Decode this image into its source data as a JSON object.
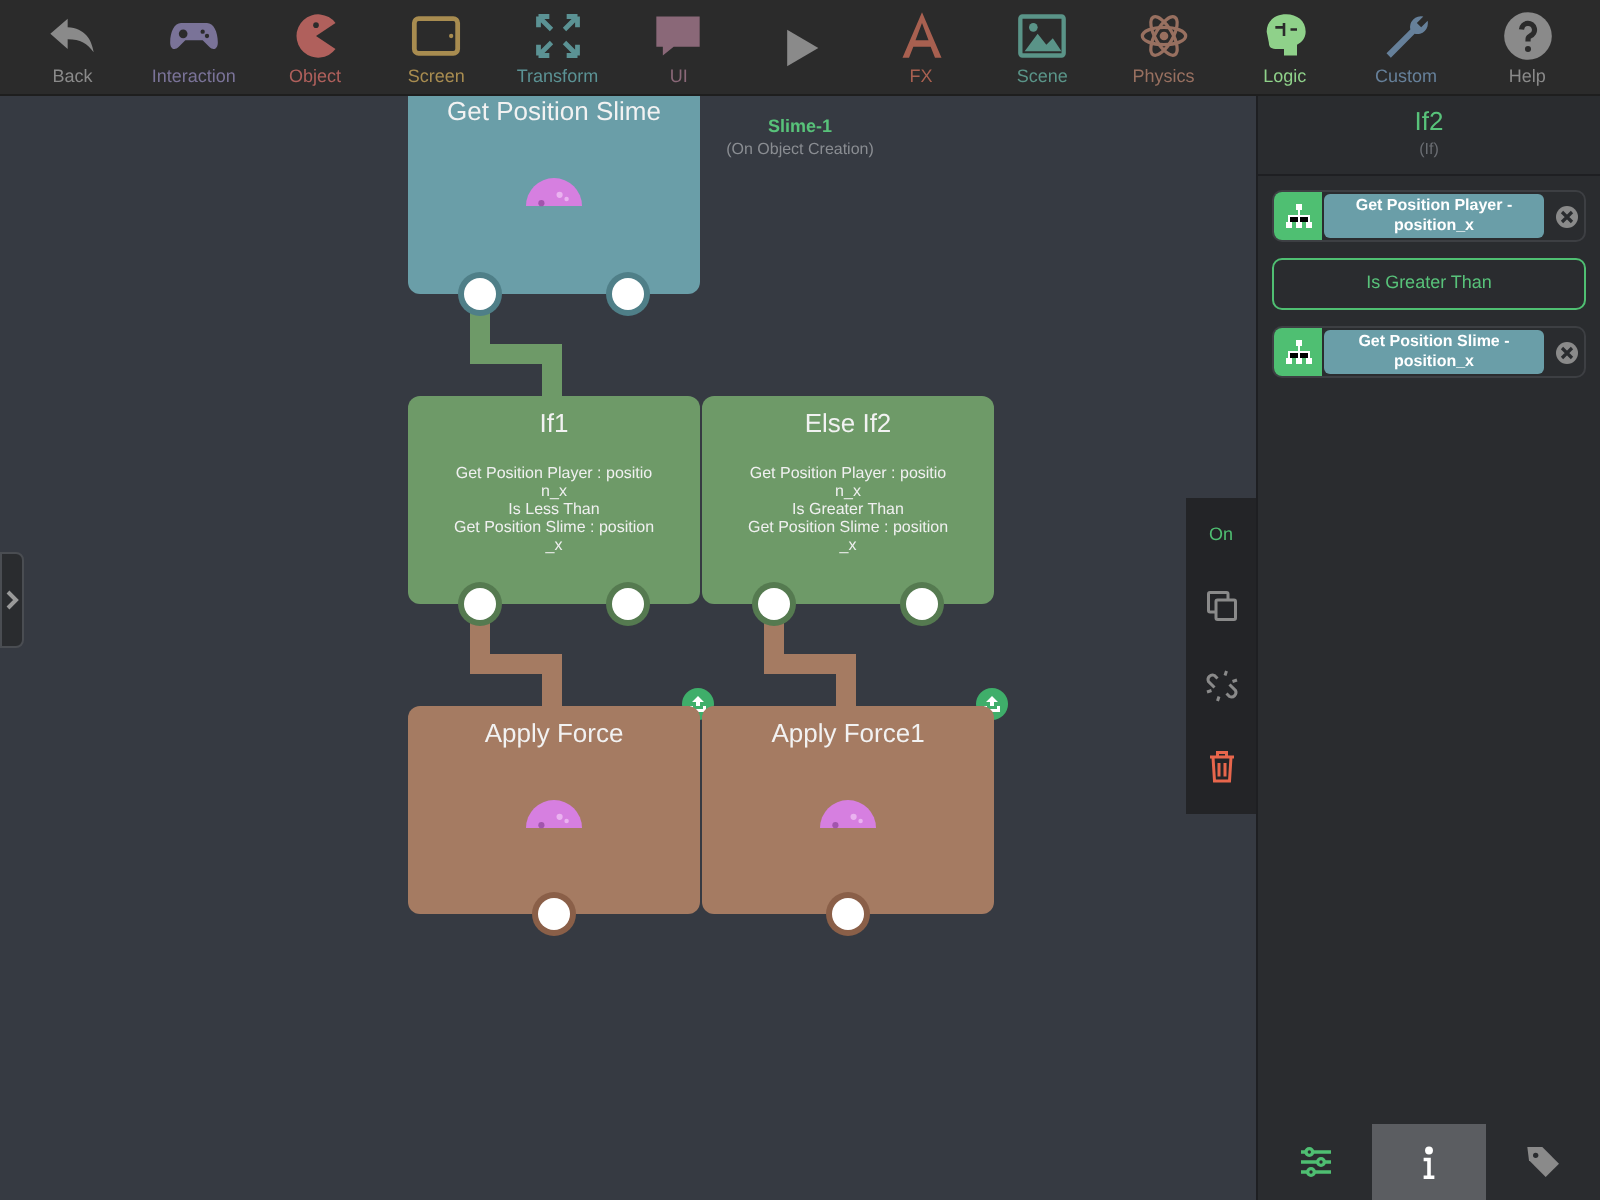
{
  "toolbar": [
    {
      "kind": "back",
      "label": "Back",
      "selected": false
    },
    {
      "kind": "gamepad",
      "label": "Interaction",
      "selected": false
    },
    {
      "kind": "pacman",
      "label": "Object",
      "selected": false
    },
    {
      "kind": "screen",
      "label": "Screen",
      "selected": false
    },
    {
      "kind": "transform",
      "label": "Transform",
      "selected": false
    },
    {
      "kind": "ui",
      "label": "UI",
      "selected": false
    },
    {
      "kind": "play",
      "selected": false
    },
    {
      "kind": "fx",
      "label": "FX",
      "selected": false
    },
    {
      "kind": "scene",
      "label": "Scene",
      "selected": false
    },
    {
      "kind": "physics",
      "label": "Physics",
      "selected": false
    },
    {
      "kind": "logic",
      "label": "Logic",
      "selected": true
    },
    {
      "kind": "custom",
      "label": "Custom",
      "selected": false
    },
    {
      "kind": "help",
      "label": "Help",
      "selected": false
    }
  ],
  "canvas": {
    "object_label": "Slime-1",
    "object_event": "(On Object Creation)",
    "nodes": [
      {
        "kind": "getter",
        "title": "Get Position Slime",
        "slime": true,
        "upload": false
      },
      {
        "kind": "condition",
        "title": "If1",
        "description": "Get Position Player : position_x\nIs Less Than\nGet Position Slime : position_x"
      },
      {
        "kind": "condition",
        "title": "Else If2",
        "description": "Get Position Player : position_x\nIs Greater Than\nGet Position Slime : position_x"
      },
      {
        "kind": "action",
        "title": "Apply Force",
        "slime": true,
        "upload": true
      },
      {
        "kind": "action",
        "title": "Apply Force1",
        "slime": true,
        "upload": true
      }
    ]
  },
  "side_tools": [
    {
      "kind": "toggle",
      "label": "On"
    },
    {
      "kind": "copy"
    },
    {
      "kind": "unlink"
    },
    {
      "kind": "delete"
    }
  ],
  "inspector": {
    "title": "If2",
    "subtitle": "(If)",
    "operands": [
      {
        "kind": "operand",
        "label": "Get Position Player - position_x"
      },
      {
        "kind": "comparison",
        "label": "Is Greater Than"
      },
      {
        "kind": "operand",
        "label": "Get Position Slime - position_x"
      }
    ],
    "tabs": [
      {
        "kind": "settings",
        "selected": false
      },
      {
        "kind": "info",
        "selected": true
      },
      {
        "kind": "tags",
        "selected": false
      }
    ]
  }
}
